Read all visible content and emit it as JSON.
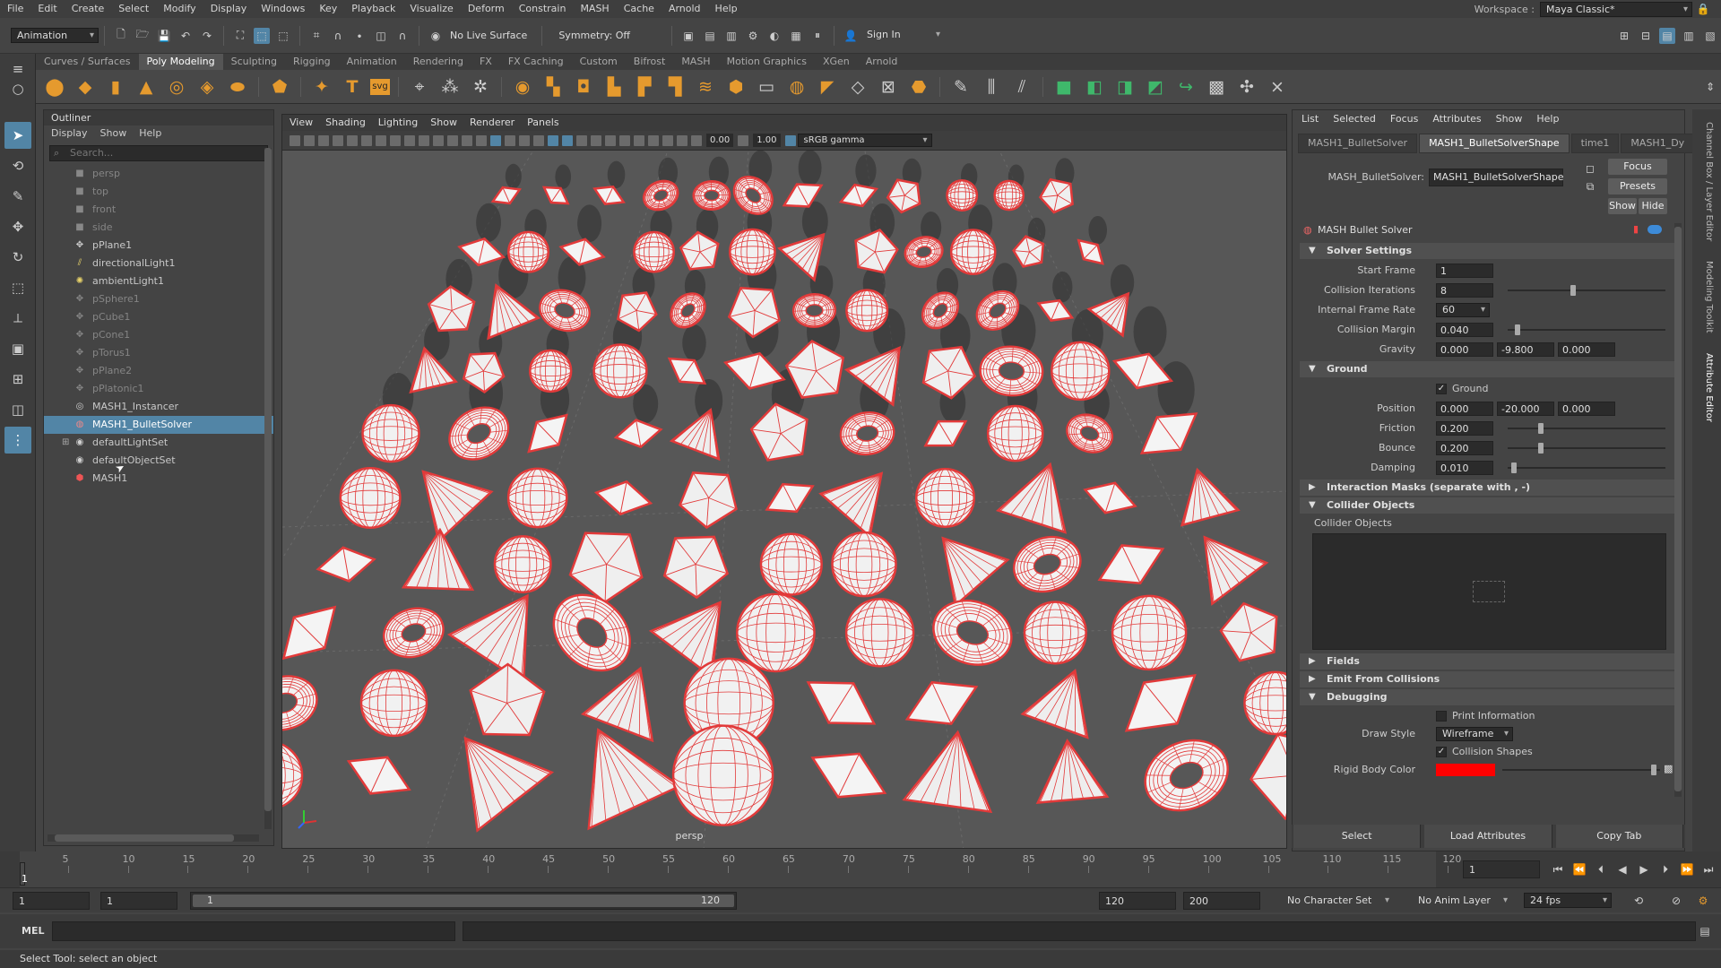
{
  "menubar": {
    "items": [
      "File",
      "Edit",
      "Create",
      "Select",
      "Modify",
      "Display",
      "Windows",
      "Key",
      "Playback",
      "Visualize",
      "Deform",
      "Constrain",
      "MASH",
      "Cache",
      "Arnold",
      "Help"
    ],
    "workspace_label": "Workspace :",
    "workspace_value": "Maya Classic*"
  },
  "statusline": {
    "mode": "Animation",
    "live_surface": "No Live Surface",
    "symmetry": "Symmetry: Off",
    "sign_in": "Sign In"
  },
  "shelf": {
    "tabs": [
      "Curves / Surfaces",
      "Poly Modeling",
      "Sculpting",
      "Rigging",
      "Animation",
      "Rendering",
      "FX",
      "FX Caching",
      "Custom",
      "Bifrost",
      "MASH",
      "Motion Graphics",
      "XGen",
      "Arnold"
    ],
    "active_tab": "Poly Modeling",
    "text_icon": "T",
    "svg_icon": "svg"
  },
  "outliner": {
    "title": "Outliner",
    "menu": [
      "Display",
      "Show",
      "Help"
    ],
    "search_placeholder": "Search...",
    "items": [
      {
        "label": "persp",
        "icon": "camera-icon",
        "dim": true
      },
      {
        "label": "top",
        "icon": "camera-icon",
        "dim": true
      },
      {
        "label": "front",
        "icon": "camera-icon",
        "dim": true
      },
      {
        "label": "side",
        "icon": "camera-icon",
        "dim": true
      },
      {
        "label": "pPlane1",
        "icon": "transform-icon",
        "dim": false
      },
      {
        "label": "directionalLight1",
        "icon": "directional-light-icon",
        "dim": false
      },
      {
        "label": "ambientLight1",
        "icon": "ambient-light-icon",
        "dim": false
      },
      {
        "label": "pSphere1",
        "icon": "transform-icon",
        "dim": true
      },
      {
        "label": "pCube1",
        "icon": "transform-icon",
        "dim": true
      },
      {
        "label": "pCone1",
        "icon": "transform-icon",
        "dim": true
      },
      {
        "label": "pTorus1",
        "icon": "transform-icon",
        "dim": true
      },
      {
        "label": "pPlane2",
        "icon": "transform-icon",
        "dim": true
      },
      {
        "label": "pPlatonic1",
        "icon": "transform-icon",
        "dim": true
      },
      {
        "label": "MASH1_Instancer",
        "icon": "mash-instancer-icon",
        "dim": false
      },
      {
        "label": "MASH1_BulletSolver",
        "icon": "bullet-solver-icon",
        "dim": false,
        "selected": true
      },
      {
        "label": "defaultLightSet",
        "icon": "set-icon",
        "dim": false,
        "expandable": true
      },
      {
        "label": "defaultObjectSet",
        "icon": "set-icon",
        "dim": false
      },
      {
        "label": "MASH1",
        "icon": "mash-network-icon",
        "dim": false
      }
    ]
  },
  "viewport": {
    "menu": [
      "View",
      "Shading",
      "Lighting",
      "Show",
      "Renderer",
      "Panels"
    ],
    "exposure": "0.00",
    "gamma": "1.00",
    "color_space": "sRGB gamma",
    "camera_label": "persp",
    "wire_color": "#e23a3a"
  },
  "attribute_editor": {
    "menu": [
      "List",
      "Selected",
      "Focus",
      "Attributes",
      "Show",
      "Help"
    ],
    "tabs": [
      "MASH1_BulletSolver",
      "MASH1_BulletSolverShape",
      "time1",
      "MASH1_Dy"
    ],
    "active_tab": "MASH1_BulletSolverShape",
    "node_label": "MASH_BulletSolver:",
    "node_value": "MASH1_BulletSolverShape",
    "buttons": {
      "focus": "Focus",
      "presets": "Presets",
      "show": "Show",
      "hide": "Hide"
    },
    "node_title": "MASH Bullet Solver",
    "solver_settings": {
      "title": "Solver Settings",
      "start_frame_label": "Start Frame",
      "start_frame": "1",
      "collision_iterations_label": "Collision Iterations",
      "collision_iterations": "8",
      "internal_frame_rate_label": "Internal Frame Rate",
      "internal_frame_rate": "60",
      "collision_margin_label": "Collision Margin",
      "collision_margin": "0.040",
      "gravity_label": "Gravity",
      "gravity": [
        "0.000",
        "-9.800",
        "0.000"
      ]
    },
    "ground": {
      "title": "Ground",
      "ground_checkbox": "Ground",
      "position_label": "Position",
      "position": [
        "0.000",
        "-20.000",
        "0.000"
      ],
      "friction_label": "Friction",
      "friction": "0.200",
      "bounce_label": "Bounce",
      "bounce": "0.200",
      "damping_label": "Damping",
      "damping": "0.010"
    },
    "interaction_masks": "Interaction Masks (separate with , -)",
    "collider_objects_title": "Collider Objects",
    "collider_objects_label": "Collider Objects",
    "fields": "Fields",
    "emit_from_collisions": "Emit From Collisions",
    "debugging": {
      "title": "Debugging",
      "print_information": "Print Information",
      "draw_style_label": "Draw Style",
      "draw_style": "Wireframe",
      "collision_shapes": "Collision Shapes",
      "rigid_body_color_label": "Rigid Body Color",
      "rigid_body_color": "#ff0000"
    },
    "bottom_buttons": [
      "Select",
      "Load Attributes",
      "Copy Tab"
    ]
  },
  "side_tabs": [
    "Channel Box / Layer Editor",
    "Modeling Toolkit",
    "Attribute Editor"
  ],
  "timeline": {
    "ticks": [
      "5",
      "10",
      "15",
      "20",
      "25",
      "30",
      "35",
      "40",
      "45",
      "50",
      "55",
      "60",
      "65",
      "70",
      "75",
      "80",
      "85",
      "90",
      "95",
      "100",
      "105",
      "110",
      "115",
      "120"
    ],
    "current_frame": "1",
    "frame_field": "1"
  },
  "range": {
    "start": "1",
    "playback_start": "1",
    "range_start": "1",
    "range_end": "120",
    "playback_end": "120",
    "end": "200",
    "character_set": "No Character Set",
    "anim_layer": "No Anim Layer",
    "fps": "24 fps"
  },
  "cmdline": {
    "label": "MEL"
  },
  "helpline": {
    "text": "Select Tool: select an object"
  }
}
